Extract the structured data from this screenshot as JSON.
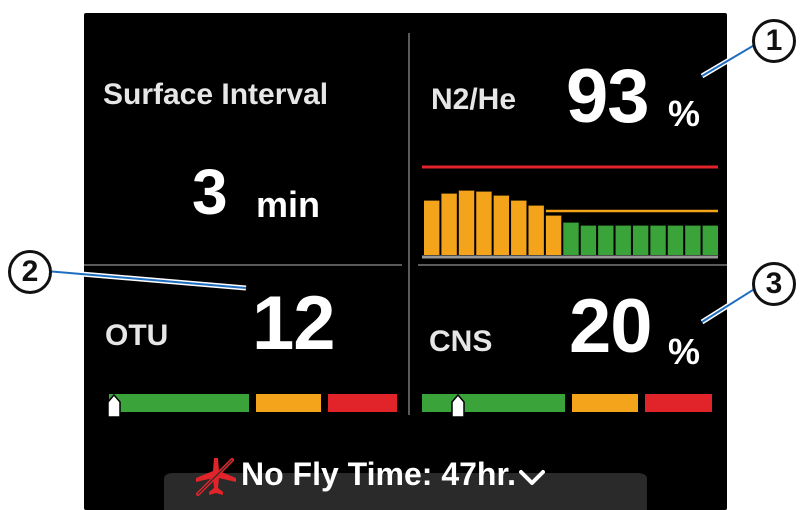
{
  "surface_interval": {
    "label": "Surface Interval",
    "value": "3",
    "unit": "min"
  },
  "n2he": {
    "label": "N2/He",
    "value": "93",
    "unit": "%",
    "chart_data": {
      "type": "bar",
      "values": [
        55,
        62,
        65,
        64,
        60,
        55,
        50,
        40,
        33,
        30,
        30,
        30,
        30,
        30,
        30,
        30,
        30
      ],
      "colors": [
        "#f3a41a",
        "#f3a41a",
        "#f3a41a",
        "#f3a41a",
        "#f3a41a",
        "#f3a41a",
        "#f3a41a",
        "#f3a41a",
        "#3aa33a",
        "#3aa33a",
        "#3aa33a",
        "#3aa33a",
        "#3aa33a",
        "#3aa33a",
        "#3aa33a",
        "#3aa33a",
        "#3aa33a"
      ],
      "ylim": [
        0,
        100
      ],
      "red_line": 88,
      "orange_line": 44
    }
  },
  "otu": {
    "label": "OTU",
    "value": "12",
    "gauge_level": 0.0
  },
  "cns": {
    "label": "CNS",
    "value": "20",
    "unit": "%",
    "gauge_level": 0.2
  },
  "no_fly": {
    "text": "No Fly Time: 47hr."
  },
  "callouts": [
    "1",
    "2",
    "3"
  ],
  "colors": {
    "green": "#3aa33a",
    "orange": "#f3a41a",
    "red": "#e0242a",
    "background": "#000000"
  },
  "icons": {
    "no_fly": "airplane-slash-icon",
    "expand": "chevron-down-icon"
  }
}
